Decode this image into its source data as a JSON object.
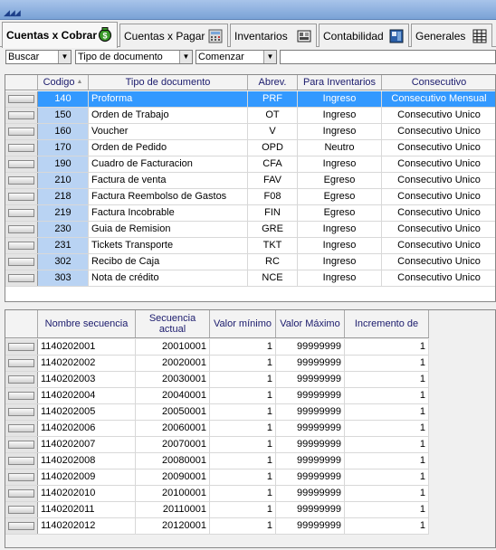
{
  "tabs": [
    {
      "label": "Cuentas x Cobrar",
      "icon": "money-bag-icon"
    },
    {
      "label": "Cuentas x Pagar",
      "icon": "calculator-icon"
    },
    {
      "label": "Inventarios",
      "icon": "warehouse-icon"
    },
    {
      "label": "Contabilidad",
      "icon": "ledger-icon"
    },
    {
      "label": "Generales",
      "icon": "grid-icon"
    }
  ],
  "filters": {
    "buscar": "Buscar",
    "campo": "Tipo de documento",
    "modo": "Comenzar",
    "texto": ""
  },
  "doc_grid": {
    "headers": [
      "Codigo",
      "Tipo de documento",
      "Abrev.",
      "Para Inventarios",
      "Consecutivo"
    ],
    "rows": [
      [
        "140",
        "Proforma",
        "PRF",
        "Ingreso",
        "Consecutivo Mensual"
      ],
      [
        "150",
        "Orden de Trabajo",
        "OT",
        "Ingreso",
        "Consecutivo Unico"
      ],
      [
        "160",
        "Voucher",
        "V",
        "Ingreso",
        "Consecutivo Unico"
      ],
      [
        "170",
        "Orden de Pedido",
        "OPD",
        "Neutro",
        "Consecutivo Unico"
      ],
      [
        "190",
        "Cuadro de Facturacion",
        "CFA",
        "Ingreso",
        "Consecutivo Unico"
      ],
      [
        "210",
        "Factura de venta",
        "FAV",
        "Egreso",
        "Consecutivo Unico"
      ],
      [
        "218",
        "Factura Reembolso de Gastos",
        "F08",
        "Egreso",
        "Consecutivo Unico"
      ],
      [
        "219",
        "Factura Incobrable",
        "FIN",
        "Egreso",
        "Consecutivo Unico"
      ],
      [
        "230",
        "Guia de Remision",
        "GRE",
        "Ingreso",
        "Consecutivo Unico"
      ],
      [
        "231",
        "Tickets Transporte",
        "TKT",
        "Ingreso",
        "Consecutivo Unico"
      ],
      [
        "302",
        "Recibo de Caja",
        "RC",
        "Ingreso",
        "Consecutivo Unico"
      ],
      [
        "303",
        "Nota de crédito",
        "NCE",
        "Ingreso",
        "Consecutivo Unico"
      ]
    ]
  },
  "seq_grid": {
    "headers": [
      "Nombre secuencia",
      "Secuencia actual",
      "Valor mínimo",
      "Valor Máximo",
      "Incremento de"
    ],
    "rows": [
      [
        "1140202001",
        "20010001",
        "1",
        "99999999",
        "1"
      ],
      [
        "1140202002",
        "20020001",
        "1",
        "99999999",
        "1"
      ],
      [
        "1140202003",
        "20030001",
        "1",
        "99999999",
        "1"
      ],
      [
        "1140202004",
        "20040001",
        "1",
        "99999999",
        "1"
      ],
      [
        "1140202005",
        "20050001",
        "1",
        "99999999",
        "1"
      ],
      [
        "1140202006",
        "20060001",
        "1",
        "99999999",
        "1"
      ],
      [
        "1140202007",
        "20070001",
        "1",
        "99999999",
        "1"
      ],
      [
        "1140202008",
        "20080001",
        "1",
        "99999999",
        "1"
      ],
      [
        "1140202009",
        "20090001",
        "1",
        "99999999",
        "1"
      ],
      [
        "1140202010",
        "20100001",
        "1",
        "99999999",
        "1"
      ],
      [
        "1140202011",
        "20110001",
        "1",
        "99999999",
        "1"
      ],
      [
        "1140202012",
        "20120001",
        "1",
        "99999999",
        "1"
      ]
    ]
  }
}
